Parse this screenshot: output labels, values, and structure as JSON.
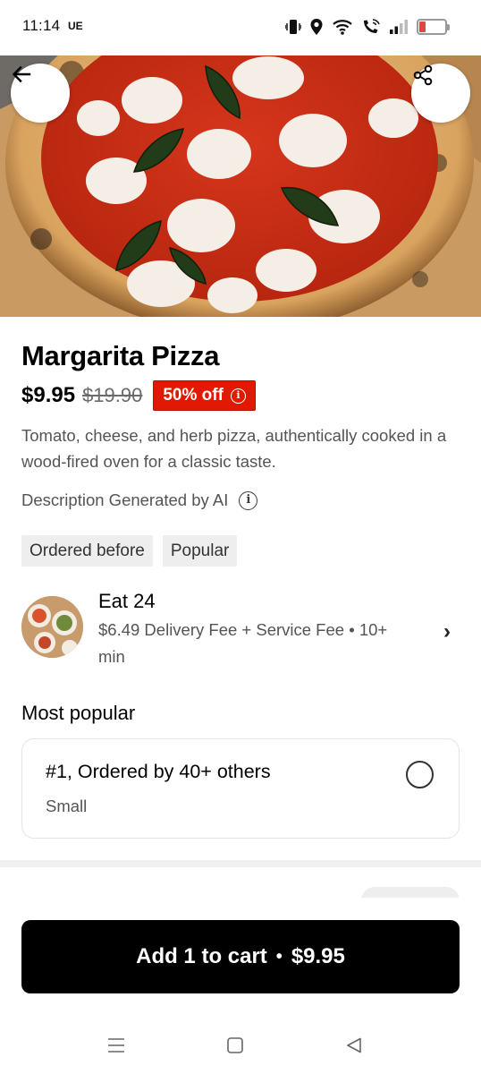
{
  "status_bar": {
    "time": "11:14",
    "carrier": "UE",
    "battery": "19",
    "icons": [
      "vibrate-icon",
      "location-icon",
      "wifi-icon",
      "wifi-call-icon",
      "signal-icon",
      "battery-icon"
    ]
  },
  "hero": {
    "image": "margherita-pizza-photo",
    "back_icon": "arrow-left-icon",
    "share_icon": "share-icon"
  },
  "product": {
    "title": "Margarita Pizza",
    "price": "$9.95",
    "original_price": "$19.90",
    "discount": "50% off",
    "description": "Tomato, cheese, and herb pizza, authentically cooked in a wood-fired oven for a classic taste.",
    "ai_note": "Description Generated by AI"
  },
  "tags": [
    "Ordered before",
    "Popular"
  ],
  "store": {
    "name": "Eat 24",
    "meta": "$6.49 Delivery Fee + Service Fee • 10+ min"
  },
  "most_popular": {
    "title": "Most popular",
    "option_label": "#1, Ordered by 40+ others",
    "option_sub": "Small",
    "selected": false
  },
  "cart": {
    "label": "Add 1 to cart",
    "separator": "•",
    "price": "$9.95"
  },
  "colors": {
    "discount_bg": "#e11900",
    "cart_bg": "#000000",
    "text_secondary": "#545454",
    "tag_bg": "#eeeeee"
  }
}
